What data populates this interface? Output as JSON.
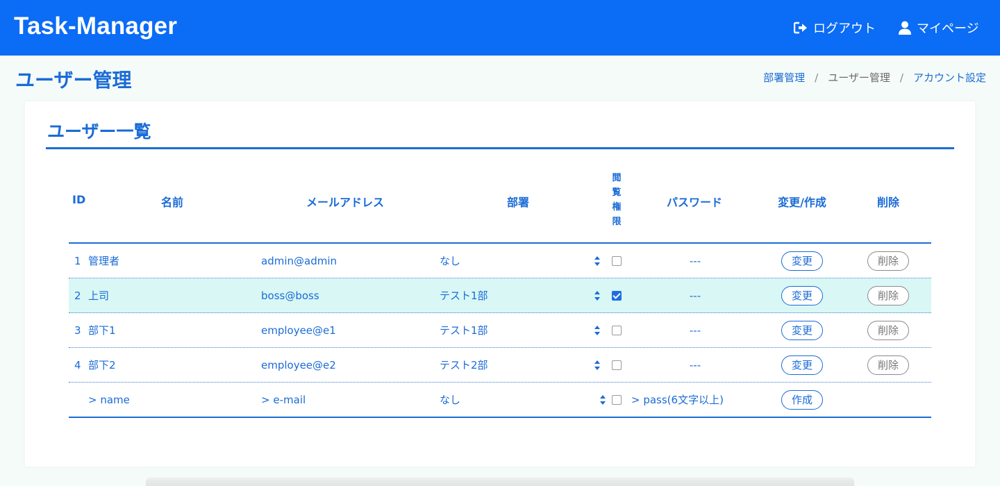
{
  "app": {
    "title": "Task-Manager"
  },
  "header": {
    "logout_label": "ログアウト",
    "mypage_label": "マイページ"
  },
  "page": {
    "title": "ユーザー管理"
  },
  "breadcrumb": {
    "items": [
      "部署管理",
      "ユーザー管理",
      "アカウント設定"
    ],
    "separator": "/"
  },
  "card": {
    "title": "ユーザー一覧"
  },
  "table": {
    "headers": {
      "id": "ID",
      "name": "名前",
      "email": "メールアドレス",
      "dept": "部署",
      "perm": [
        "閲",
        "覧",
        "権",
        "限"
      ],
      "password": "パスワード",
      "edit": "変更/作成",
      "delete": "削除"
    },
    "rows": [
      {
        "id": "1",
        "name": "管理者",
        "email": "admin@admin",
        "dept": "なし",
        "perm": false,
        "password": "---",
        "edit": "変更",
        "delete": "削除",
        "highlighted": false
      },
      {
        "id": "2",
        "name": "上司",
        "email": "boss@boss",
        "dept": "テスト1部",
        "perm": true,
        "password": "---",
        "edit": "変更",
        "delete": "削除",
        "highlighted": true
      },
      {
        "id": "3",
        "name": "部下1",
        "email": "employee@e1",
        "dept": "テスト1部",
        "perm": false,
        "password": "---",
        "edit": "変更",
        "delete": "削除",
        "highlighted": false
      },
      {
        "id": "4",
        "name": "部下2",
        "email": "employee@e2",
        "dept": "テスト2部",
        "perm": false,
        "password": "---",
        "edit": "変更",
        "delete": "削除",
        "highlighted": false
      }
    ],
    "new_row": {
      "name_placeholder": "> name",
      "email_placeholder": "> e-mail",
      "dept": "なし",
      "perm": false,
      "password_placeholder": "> pass(6文字以上)",
      "create": "作成"
    }
  },
  "colors": {
    "header_bg": "#0b6cf5",
    "accent": "#1a6bd6",
    "highlight_row": "#d8f7f5"
  },
  "icons": {
    "logout": "sign-out-icon",
    "mypage": "user-icon",
    "select": "select-arrows-icon"
  }
}
